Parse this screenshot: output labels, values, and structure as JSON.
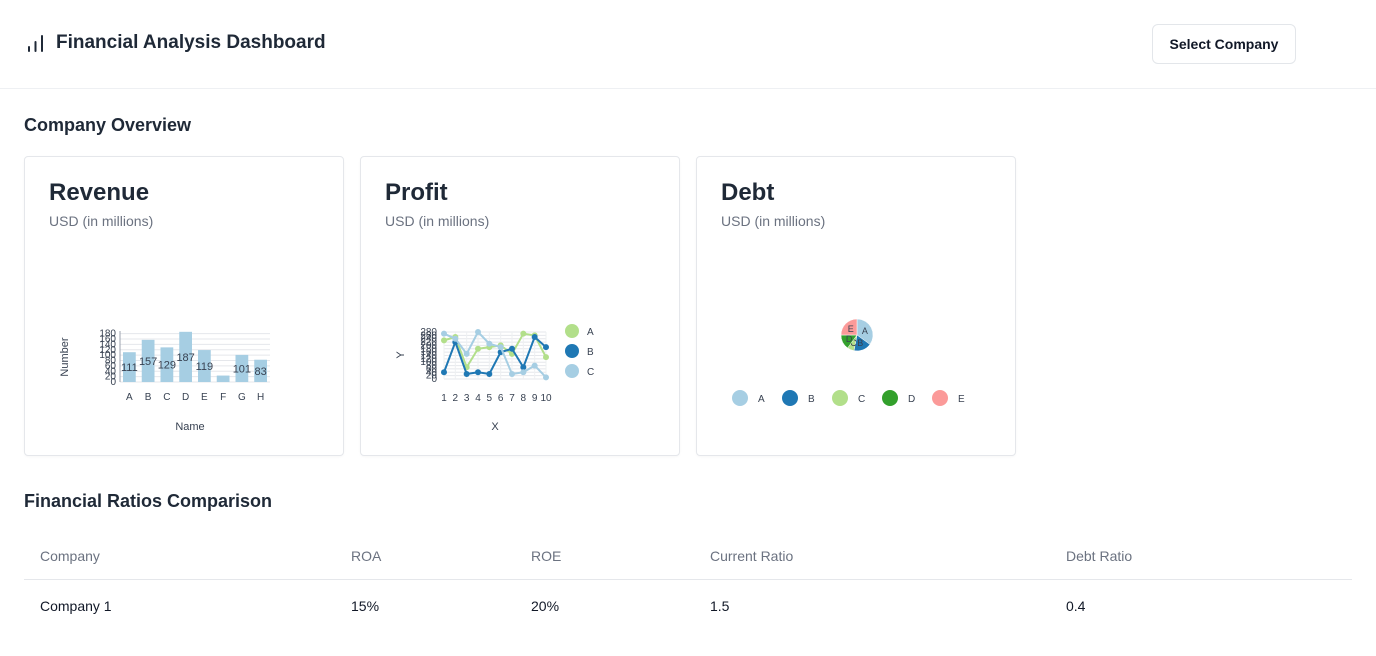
{
  "header": {
    "title": "Financial Analysis Dashboard",
    "icon": "bar-chart-icon",
    "select_company_label": "Select Company"
  },
  "overview": {
    "section_title": "Company Overview",
    "cards": [
      {
        "title": "Revenue",
        "subtitle": "USD (in millions)"
      },
      {
        "title": "Profit",
        "subtitle": "USD (in millions)"
      },
      {
        "title": "Debt",
        "subtitle": "USD (in millions)"
      }
    ]
  },
  "ratios": {
    "section_title": "Financial Ratios Comparison",
    "columns": [
      "Company",
      "ROA",
      "ROE",
      "Current Ratio",
      "Debt Ratio"
    ],
    "rows": [
      [
        "Company 1",
        "15%",
        "20%",
        "1.5",
        "0.4"
      ]
    ]
  },
  "chart_data": [
    {
      "type": "bar",
      "xlabel": "Name",
      "ylabel": "Number",
      "categories": [
        "A",
        "B",
        "C",
        "D",
        "E",
        "F",
        "G",
        "H"
      ],
      "values": [
        111,
        157,
        129,
        187,
        119,
        24,
        101,
        83
      ],
      "yticks": [
        0,
        20,
        40,
        60,
        80,
        100,
        120,
        140,
        160,
        180
      ],
      "ylim": [
        0,
        190
      ],
      "color": "#a6cee3"
    },
    {
      "type": "line",
      "xlabel": "X",
      "ylabel": "Y",
      "x": [
        1,
        2,
        3,
        4,
        5,
        6,
        7,
        8,
        9,
        10
      ],
      "xticks": [
        "1",
        "2",
        "3",
        "4",
        "5",
        "6",
        "7",
        "8",
        "9",
        "10"
      ],
      "yticks": [
        0,
        20,
        40,
        60,
        80,
        100,
        120,
        140,
        160,
        180,
        200,
        220,
        240,
        260,
        280
      ],
      "ylim": [
        0,
        280
      ],
      "legend": "right",
      "series": [
        {
          "name": "A",
          "color": "#b2df8a",
          "values": [
            230,
            250,
            70,
            180,
            190,
            200,
            150,
            270,
            260,
            130
          ]
        },
        {
          "name": "B",
          "color": "#1f78b4",
          "values": [
            40,
            220,
            30,
            40,
            30,
            160,
            180,
            70,
            250,
            190
          ]
        },
        {
          "name": "C",
          "color": "#a6cee3",
          "values": [
            270,
            240,
            150,
            280,
            210,
            190,
            30,
            40,
            80,
            10
          ]
        }
      ]
    },
    {
      "type": "pie",
      "labels": [
        "A",
        "B",
        "C",
        "D",
        "E"
      ],
      "values": [
        35,
        18,
        7,
        15,
        25
      ],
      "colors": [
        "#a6cee3",
        "#1f78b4",
        "#b2df8a",
        "#33a02c",
        "#fb9a99"
      ],
      "legend": "bottom"
    }
  ]
}
